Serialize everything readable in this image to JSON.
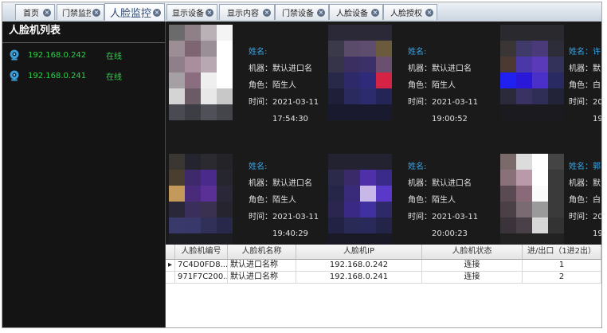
{
  "tabs": [
    {
      "label": "首页"
    },
    {
      "label": "门禁监控"
    },
    {
      "label": "人脸监控"
    },
    {
      "label": "显示设备"
    },
    {
      "label": "显示内容"
    },
    {
      "label": "门禁设备"
    },
    {
      "label": "人脸设备"
    },
    {
      "label": "人脸授权"
    }
  ],
  "sidebar": {
    "title": "人脸机列表",
    "devices": [
      {
        "ip": "192.168.0.242",
        "status": "在线"
      },
      {
        "ip": "192.168.0.241",
        "status": "在线"
      }
    ]
  },
  "cards": [
    {
      "name_label": "姓名:",
      "machine": "机器：默认进口名",
      "role": "角色：陌生人",
      "time_label": "时间：2021-03-11",
      "time2": "17:54:30"
    },
    {
      "name_label": "姓名:",
      "machine": "机器：默认进口名",
      "role": "角色：陌生人",
      "time_label": "时间：2021-03-11",
      "time2": "19:00:52"
    },
    {
      "name_label": "姓名：许",
      "machine": "机器：默",
      "role": "角色：白",
      "time_label": "时间：20",
      "time2": "19"
    },
    {
      "name_label": "姓名:",
      "machine": "机器：默认进口名",
      "role": "角色：陌生人",
      "time_label": "时间：2021-03-11",
      "time2": "19:40:29"
    },
    {
      "name_label": "姓名:",
      "machine": "机器：默认进口名",
      "role": "角色：陌生人",
      "time_label": "时间：2021-03-11",
      "time2": "20:00:23"
    },
    {
      "name_label": "姓名：郭",
      "machine": "机器：默",
      "role": "角色：白",
      "time_label": "时间：20",
      "time2": "19"
    }
  ],
  "table": {
    "headers": [
      "人脸机编号",
      "人脸机名称",
      "人脸机IP",
      "人脸机状态",
      "进/出口（1进2出）"
    ],
    "rows": [
      {
        "marker": "▸",
        "id": "7C4D0FD8...",
        "name": "默认进口名称",
        "ip": "192.168.0.242",
        "state": "连接",
        "dir": "1"
      },
      {
        "marker": "",
        "id": "971F7C200...",
        "name": "默认进口名称",
        "ip": "192.168.0.241",
        "state": "连接",
        "dir": "2"
      }
    ]
  },
  "colors": {
    "accent": "#38a6e8",
    "online": "#2fd14a",
    "panel_bg": "#141414"
  }
}
